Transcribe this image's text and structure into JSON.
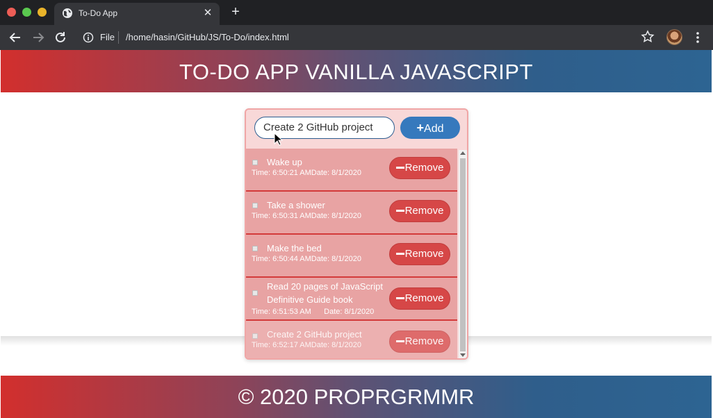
{
  "browser": {
    "tab_title": "To-Do App",
    "new_tab_label": "+",
    "close_tab_label": "✕",
    "omnibox_scheme": "File",
    "url": "/home/hasin/GitHub/JS/To-Do/index.html"
  },
  "page": {
    "header_title": "TO-DO APP VANILLA JAVASCRIPT",
    "footer_text": "© 2020 PROPRGRMMR"
  },
  "form": {
    "input_value": "Create 2 GitHub project",
    "add_label": "Add"
  },
  "tasks": [
    {
      "text": "Wake up",
      "meta": "Time: 6:50:21 AMDate: 8/1/2020",
      "remove_label": "Remove"
    },
    {
      "text": "Take a shower",
      "meta": "Time: 6:50:31 AMDate: 8/1/2020",
      "remove_label": "Remove"
    },
    {
      "text": "Make the bed",
      "meta": "Time: 6:50:44 AMDate: 8/1/2020",
      "remove_label": "Remove"
    },
    {
      "text": "Read 20 pages of JavaScript Definitive Guide book",
      "meta": "Time: 6:51:53 AM      Date: 8/1/2020",
      "remove_label": "Remove"
    },
    {
      "text": "Create 2 GitHub project",
      "meta": "Time: 6:52:17 AMDate: 8/1/2020",
      "remove_label": "Remove"
    }
  ],
  "colors": {
    "header_gradient_start": "#d22f2d",
    "header_gradient_end": "#2d6492",
    "add_button": "#3679bd",
    "remove_button": "#d64747",
    "task_background": "#e8a3a3"
  }
}
